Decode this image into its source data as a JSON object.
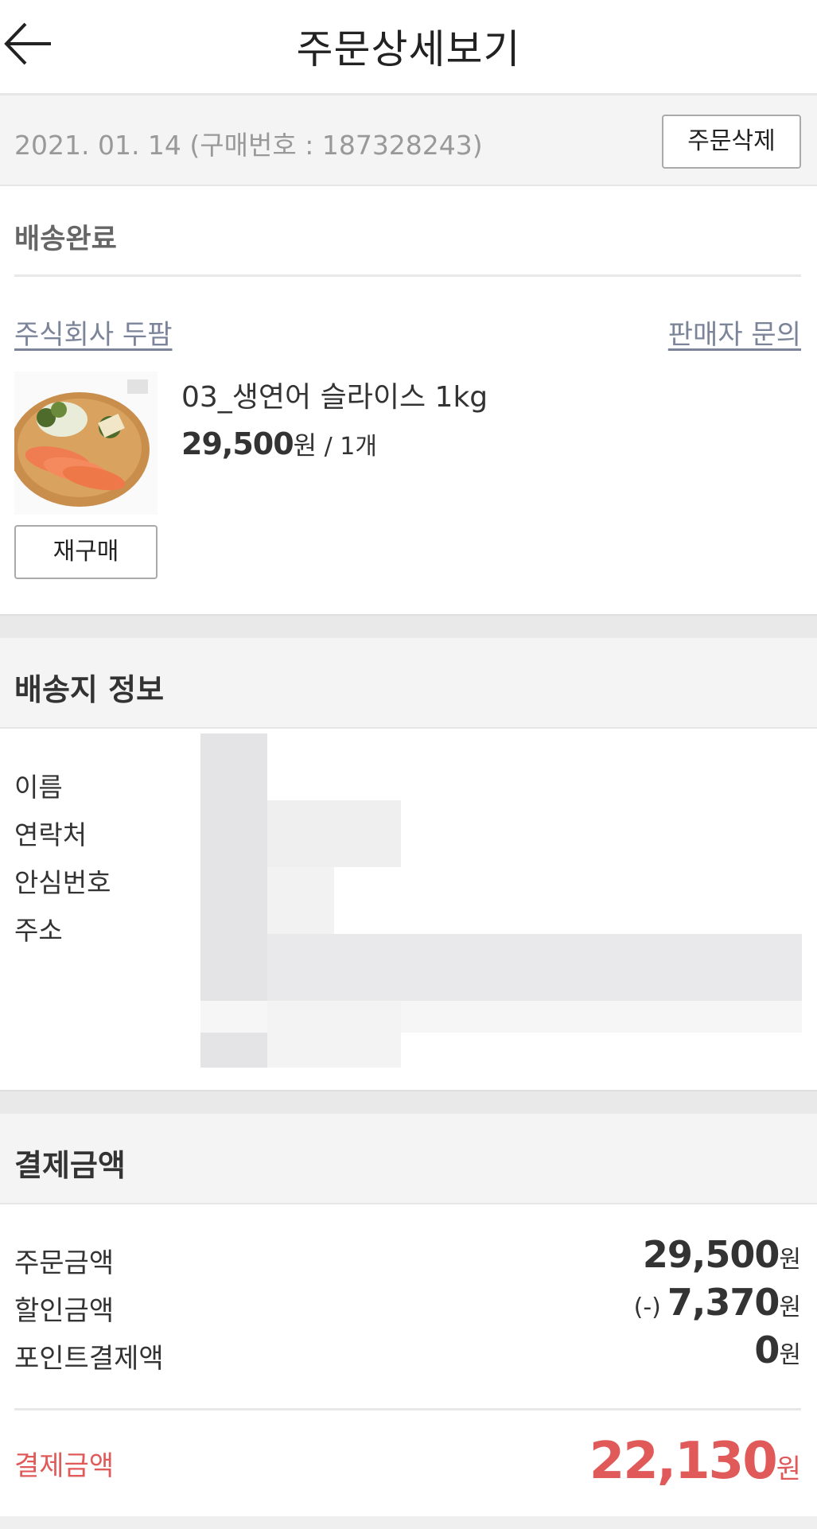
{
  "header": {
    "title": "주문상세보기",
    "back_icon": "arrow-left-icon"
  },
  "order": {
    "info": "2021. 01. 14 (구매번호 : 187328243)",
    "delete_label": "주문삭제"
  },
  "delivery": {
    "status": "배송완료"
  },
  "seller": {
    "name": "주식회사 두팜",
    "inquiry_label": "판매자 문의"
  },
  "product": {
    "name": "03_생연어 슬라이스 1kg",
    "price": "29,500",
    "price_unit": "원",
    "quantity": " / 1개",
    "rebuy_label": "재구매"
  },
  "shipping": {
    "title": "배송지 정보",
    "labels": [
      "이름",
      "연락처",
      "안심번호",
      "주소"
    ]
  },
  "payment": {
    "title": "결제금액",
    "rows": [
      {
        "label": "주문금액",
        "prefix": "",
        "value": "29,500",
        "unit": "원"
      },
      {
        "label": "할인금액",
        "prefix": "(-)",
        "value": "7,370",
        "unit": "원"
      },
      {
        "label": "포인트결제액",
        "prefix": "",
        "value": "0",
        "unit": "원"
      }
    ],
    "total_label": "결제금액",
    "total_value": "22,130",
    "total_unit": "원"
  },
  "colors": {
    "accent_red": "#e05a5a",
    "link_gray": "#7b8499",
    "section_bg": "#f4f4f4"
  }
}
